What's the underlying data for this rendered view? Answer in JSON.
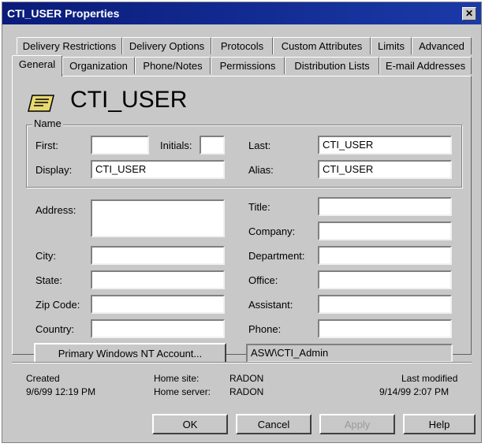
{
  "window": {
    "title": "CTI_USER Properties",
    "close_glyph": "✕"
  },
  "tabs_row1": [
    "Delivery Restrictions",
    "Delivery Options",
    "Protocols",
    "Custom Attributes",
    "Limits",
    "Advanced"
  ],
  "tabs_row2": [
    "General",
    "Organization",
    "Phone/Notes",
    "Permissions",
    "Distribution Lists",
    "E-mail Addresses"
  ],
  "selected_tab": "General",
  "header": {
    "display_title": "CTI_USER",
    "icon": "mailbox-card-icon"
  },
  "name_group": {
    "legend": "Name",
    "first_label": "First:",
    "first_value": "",
    "initials_label": "Initials:",
    "initials_value": "",
    "last_label": "Last:",
    "last_value": "CTI_USER",
    "display_label": "Display:",
    "display_value": "CTI_USER",
    "alias_label": "Alias:",
    "alias_value": "CTI_USER"
  },
  "address": {
    "address_label": "Address:",
    "address_value": "",
    "city_label": "City:",
    "city_value": "",
    "state_label": "State:",
    "state_value": "",
    "zip_label": "Zip Code:",
    "zip_value": "",
    "country_label": "Country:",
    "country_value": ""
  },
  "org": {
    "title_label": "Title:",
    "title_value": "",
    "company_label": "Company:",
    "company_value": "",
    "department_label": "Department:",
    "department_value": "",
    "office_label": "Office:",
    "office_value": "",
    "assistant_label": "Assistant:",
    "assistant_value": "",
    "phone_label": "Phone:",
    "phone_value": ""
  },
  "nt_account": {
    "button_label": "Primary Windows NT Account...",
    "value": "ASW\\CTI_Admin"
  },
  "footer_info": {
    "created_label": "Created",
    "created_value": "9/6/99  12:19 PM",
    "home_site_label": "Home site:",
    "home_site_value": "RADON",
    "home_server_label": "Home server:",
    "home_server_value": "RADON",
    "last_modified_label": "Last modified",
    "last_modified_value": "9/14/99  2:07 PM"
  },
  "buttons": {
    "ok": "OK",
    "cancel": "Cancel",
    "apply": "Apply",
    "help": "Help"
  },
  "colors": {
    "titlebar": "#0a1b7a",
    "face": "#c8c8c8",
    "disabled_text": "#9a9a9a"
  }
}
